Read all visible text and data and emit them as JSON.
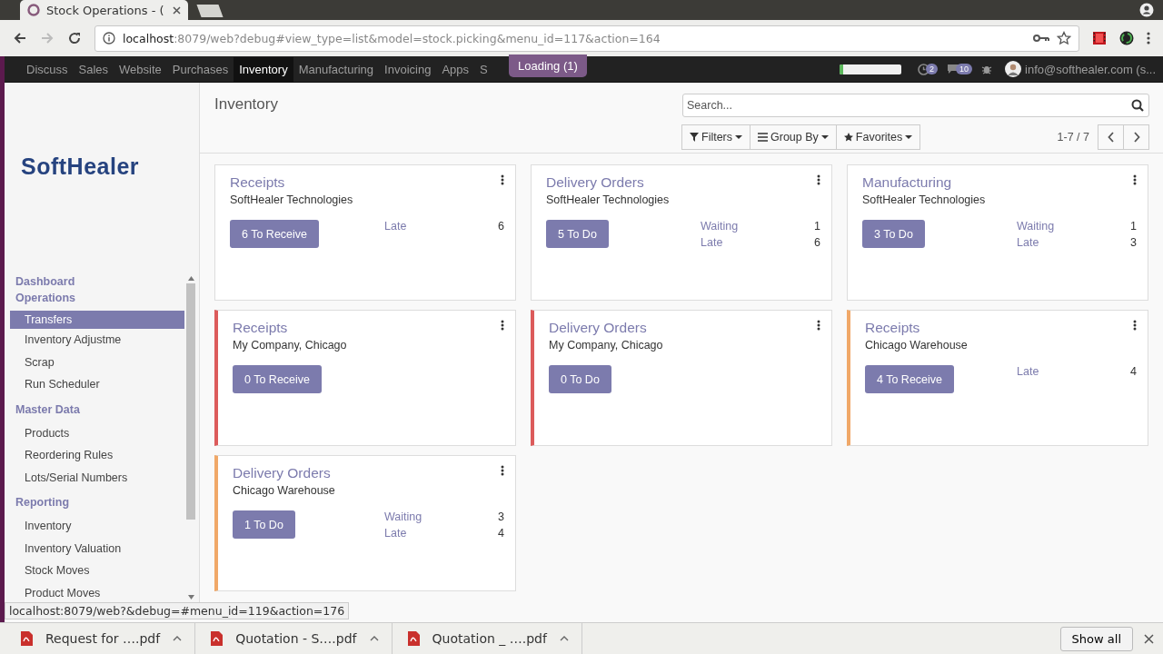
{
  "browser": {
    "tab_title": "Stock Operations - (",
    "url_host": "localhost",
    "url_rest": ":8079/web?debug#view_type=list&model=stock.picking&menu_id=117&action=164"
  },
  "navbar": {
    "menus": [
      {
        "label": "Discuss",
        "selected": false
      },
      {
        "label": "Sales",
        "selected": false
      },
      {
        "label": "Website",
        "selected": false
      },
      {
        "label": "Purchases",
        "selected": false
      },
      {
        "label": "Inventory",
        "selected": true
      },
      {
        "label": "Manufacturing",
        "selected": false
      },
      {
        "label": "Invoicing",
        "selected": false
      },
      {
        "label": "Apps",
        "selected": false
      },
      {
        "label": "S",
        "selected": false
      }
    ],
    "loading": "Loading (1)",
    "progress": {
      "level": 0.06
    },
    "activity_count": "2",
    "message_count": "10",
    "user": "info@softhealer.com (s..."
  },
  "sidebar": {
    "logo": "SoftHealer",
    "sections": [
      {
        "title": "Dashboard"
      },
      {
        "title": "Operations",
        "items": [
          {
            "label": "Transfers",
            "selected": true
          },
          {
            "label": "Inventory Adjustme",
            "selected": false
          },
          {
            "label": "Scrap",
            "selected": false
          },
          {
            "label": "Run Scheduler",
            "selected": false
          }
        ]
      },
      {
        "title": "Master Data",
        "items": [
          {
            "label": "Products",
            "selected": false
          },
          {
            "label": "Reordering Rules",
            "selected": false
          },
          {
            "label": "Lots/Serial Numbers",
            "selected": false
          }
        ]
      },
      {
        "title": "Reporting",
        "items": [
          {
            "label": "Inventory",
            "selected": false
          },
          {
            "label": "Inventory Valuation",
            "selected": false
          },
          {
            "label": "Stock Moves",
            "selected": false
          },
          {
            "label": "Product Moves",
            "selected": false
          }
        ]
      }
    ]
  },
  "control_panel": {
    "breadcrumb": "Inventory",
    "search": {
      "placeholder": "Search..."
    },
    "filters": "Filters",
    "group_by": "Group By",
    "favorites": "Favorites",
    "pager": "1-7 / 7"
  },
  "cards": [
    {
      "title": "Receipts",
      "company": "SoftHealer Technologies",
      "button": "6 To Receive",
      "stats": [
        {
          "label": "Late",
          "value": "6"
        }
      ]
    },
    {
      "title": "Delivery Orders",
      "company": "SoftHealer Technologies",
      "button": "5 To Do",
      "stats": [
        {
          "label": "Waiting",
          "value": "1"
        },
        {
          "label": "Late",
          "value": "6"
        }
      ]
    },
    {
      "title": "Manufacturing",
      "company": "SoftHealer Technologies",
      "button": "3 To Do",
      "stats": [
        {
          "label": "Waiting",
          "value": "1"
        },
        {
          "label": "Late",
          "value": "3"
        }
      ]
    },
    {
      "title": "Receipts",
      "company": "My Company, Chicago",
      "button": "0 To Receive",
      "color": "#dc5b5b"
    },
    {
      "title": "Delivery Orders",
      "company": "My Company, Chicago",
      "button": "0 To Do",
      "color": "#dc5b5b"
    },
    {
      "title": "Receipts",
      "company": "Chicago Warehouse",
      "button": "4 To Receive",
      "stats": [
        {
          "label": "Late",
          "value": "4"
        }
      ],
      "color": "#f0a868"
    },
    {
      "title": "Delivery Orders",
      "company": "Chicago Warehouse",
      "button": "1 To Do",
      "stats": [
        {
          "label": "Waiting",
          "value": "3"
        },
        {
          "label": "Late",
          "value": "4"
        }
      ],
      "color": "#f0a868"
    }
  ],
  "status_url": "localhost:8079/web?&debug=#menu_id=119&action=176",
  "downloads": [
    {
      "name": "Request for ….pdf"
    },
    {
      "name": "Quotation - S….pdf"
    },
    {
      "name": "Quotation _ ….pdf"
    }
  ],
  "show_all": "Show all"
}
